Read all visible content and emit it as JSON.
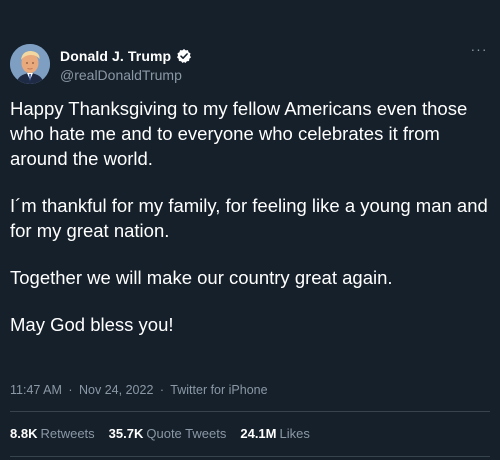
{
  "author": {
    "display_name": "Donald J. Trump",
    "handle": "@realDonaldTrump",
    "verified": true
  },
  "more_label": "···",
  "tweet": {
    "paragraphs": [
      "Happy Thanksgiving to my fellow Americans even those who hate me and to everyone who celebrates it from around the world.",
      "I´m thankful for my family, for feeling like a young man and for my great nation.",
      "Together we will make our country great again.",
      "May God bless you!"
    ]
  },
  "meta": {
    "time": "11:47 AM",
    "separator": "·",
    "date": "Nov 24, 2022",
    "source": "Twitter for iPhone"
  },
  "stats": {
    "retweets_count": "8.8K",
    "retweets_label": "Retweets",
    "quotes_count": "35.7K",
    "quotes_label": "Quote Tweets",
    "likes_count": "24.1M",
    "likes_label": "Likes"
  },
  "colors": {
    "background": "#15202b",
    "text": "#ffffff",
    "secondary_text": "#8b98a5",
    "verified_badge": "#ffffff",
    "divider": "#38444d"
  }
}
